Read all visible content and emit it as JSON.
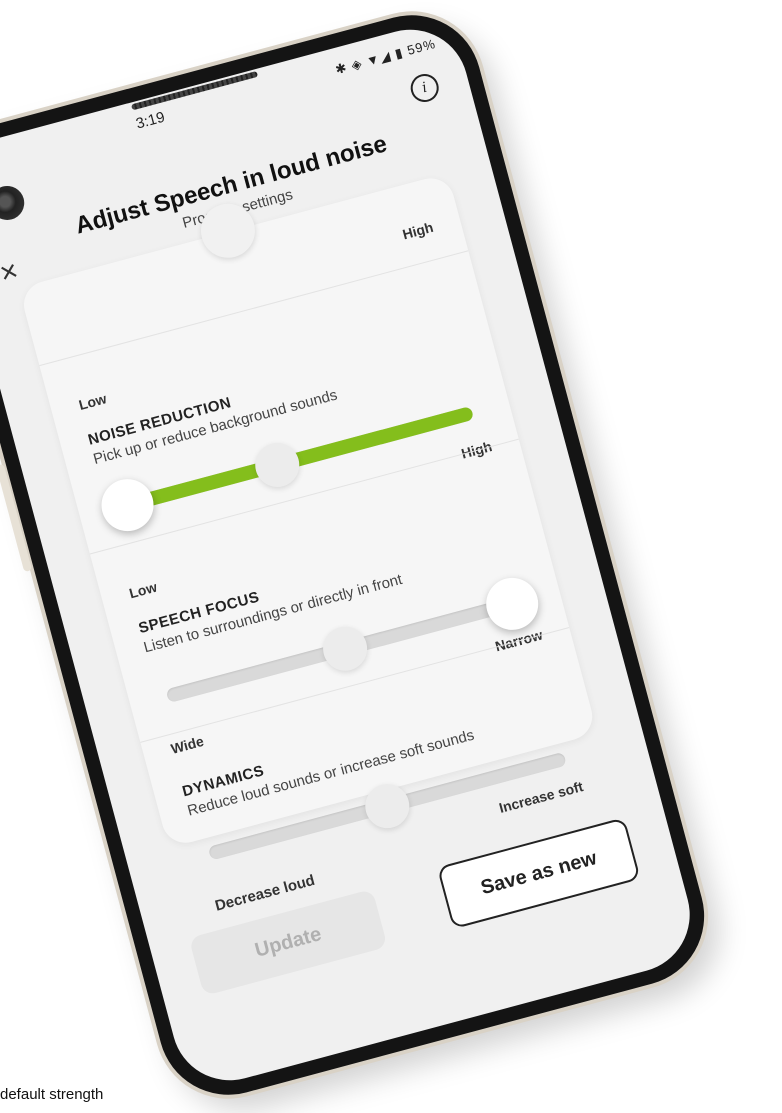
{
  "status_bar": {
    "time": "3:19",
    "icons_text": "✱ ◈ ▼◢ ▮ 59%"
  },
  "header": {
    "title": "Adjust Speech in loud noise",
    "subtitle": "Program settings",
    "close_glyph": "×",
    "info_glyph": "i"
  },
  "top_slider": {
    "high_label": "High"
  },
  "sliders": [
    {
      "id": "noise-reduction",
      "low_label": "Low",
      "title": "NOISE REDUCTION",
      "description": "Pick up or reduce background sounds",
      "high_label": "High",
      "value_fraction": 0.03,
      "default_fraction": 0.45,
      "fill_color": "#84be1c",
      "filled": true
    },
    {
      "id": "speech-focus",
      "low_label": "Low",
      "title": "SPEECH FOCUS",
      "description": "Listen to surroundings or directly in front",
      "high_label": "Narrow",
      "value_fraction": 0.97,
      "default_fraction": 0.5,
      "filled": false
    },
    {
      "id": "dynamics",
      "low_label": "Wide",
      "title": "DYNAMICS",
      "description": "Reduce loud sounds or increase soft sounds",
      "high_label": "Increase soft",
      "value_fraction": 0.5,
      "filled": false
    }
  ],
  "dynamics_low_label": "Decrease loud",
  "buttons": {
    "update": "Update",
    "save_as_new": "Save as new"
  },
  "caption": "default strength",
  "colors": {
    "accent_green": "#84be1c",
    "phone_frame": "#141414",
    "screen_bg": "#f0f0f0"
  }
}
